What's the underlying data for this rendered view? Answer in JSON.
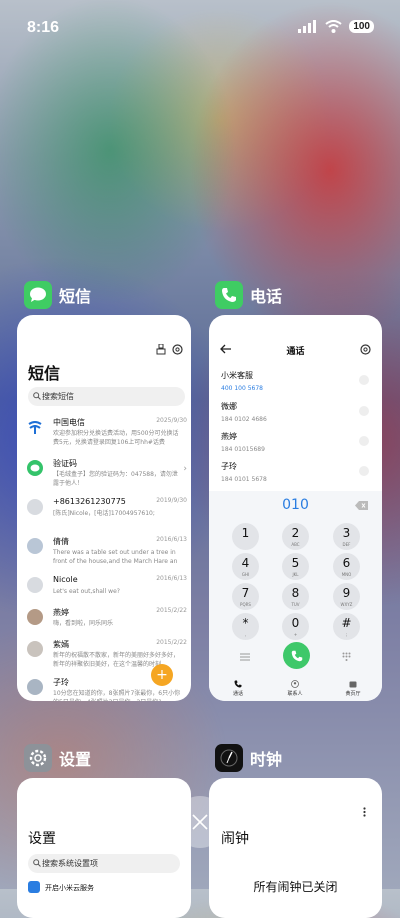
{
  "status": {
    "time": "8:16",
    "battery": "100"
  },
  "apps": {
    "sms": {
      "name": "短信",
      "icon": "message-icon"
    },
    "phone": {
      "name": "电话",
      "icon": "phone-icon"
    },
    "settings": {
      "name": "设置",
      "icon": "settings-icon"
    },
    "clock": {
      "name": "时钟",
      "icon": "clock-icon"
    }
  },
  "sms_card": {
    "title": "短信",
    "search_placeholder": "搜索短信",
    "messages": [
      {
        "name": "中国电信",
        "date": "2025/9/30",
        "preview": "欢迎参加积分兑换话费活动，用500分可兑换话费5元，兑换请登录回复106上可hh#话费",
        "avatar_color": "#1e6fd6"
      },
      {
        "name": "验证码",
        "date": "",
        "preview": "【毛绒盒子】您的验证码为：047588，请勿泄露于他人！",
        "avatar_color": "#34c36a"
      },
      {
        "name": "+8613261230775",
        "date": "2019/9/30",
        "preview": "[陈氏]Nicole，[电话]17004957610;",
        "avatar_color": "#d8dbe0"
      },
      {
        "name": "倩倩",
        "date": "2016/6/13",
        "preview": "There was a table set out under a tree in front of the house,and the March Hare an",
        "avatar_color": "#b9c6d6"
      },
      {
        "name": "Nicole",
        "date": "2016/6/13",
        "preview": "Let's eat out,shall we?",
        "avatar_color": "#d8dbe0"
      },
      {
        "name": "燕婷",
        "date": "2015/2/22",
        "preview": "嗨，看到啦，同乐同乐",
        "avatar_color": "#b49a86"
      },
      {
        "name": "紫嫣",
        "date": "2015/2/22",
        "preview": "新年的祝福散不散家，新年的美丽好多好多好，新年的祥聚依旧美好，在这个温馨的时刻",
        "avatar_color": "#c9c3bd"
      },
      {
        "name": "子玲",
        "date": "",
        "preview": "10分您在知道的你，8张照片7张最你，6只小你的5只最你，4张照片3只最你，2只最你1",
        "avatar_color": "#a9b5c3"
      }
    ],
    "fab": "+"
  },
  "phone_card": {
    "title": "通话",
    "contacts": [
      {
        "name": "小米客服",
        "number": "400 100 5678"
      },
      {
        "name": "微娜",
        "number": "184 0102 4686"
      },
      {
        "name": "燕婷",
        "number": "184 01015689"
      },
      {
        "name": "子玲",
        "number": "184 0101 5678"
      }
    ],
    "dialed_number": "010",
    "keys": [
      {
        "digit": "1",
        "letters": ""
      },
      {
        "digit": "2",
        "letters": "ABC"
      },
      {
        "digit": "3",
        "letters": "DEF"
      },
      {
        "digit": "4",
        "letters": "GHI"
      },
      {
        "digit": "5",
        "letters": "JKL"
      },
      {
        "digit": "6",
        "letters": "MNO"
      },
      {
        "digit": "7",
        "letters": "PQRS"
      },
      {
        "digit": "8",
        "letters": "TUV"
      },
      {
        "digit": "9",
        "letters": "WXYZ"
      },
      {
        "digit": "*",
        "letters": ","
      },
      {
        "digit": "0",
        "letters": "+"
      },
      {
        "digit": "#",
        "letters": ";"
      }
    ],
    "nav": {
      "calls": "通话",
      "contacts": "联系人",
      "yellow_pages": "黄页厅"
    }
  },
  "settings_card": {
    "title": "设置",
    "search_placeholder": "搜索系统设置项",
    "first_item": "开启小米云服务"
  },
  "clock_card": {
    "title": "闹钟",
    "status_text": "所有闹钟已关闭"
  },
  "colors": {
    "sms_green": "#3fcc63",
    "phone_green": "#3fcc63",
    "call_button": "#3ec86a",
    "accent_blue": "#2a7de1",
    "fab_orange": "#f5a623"
  }
}
